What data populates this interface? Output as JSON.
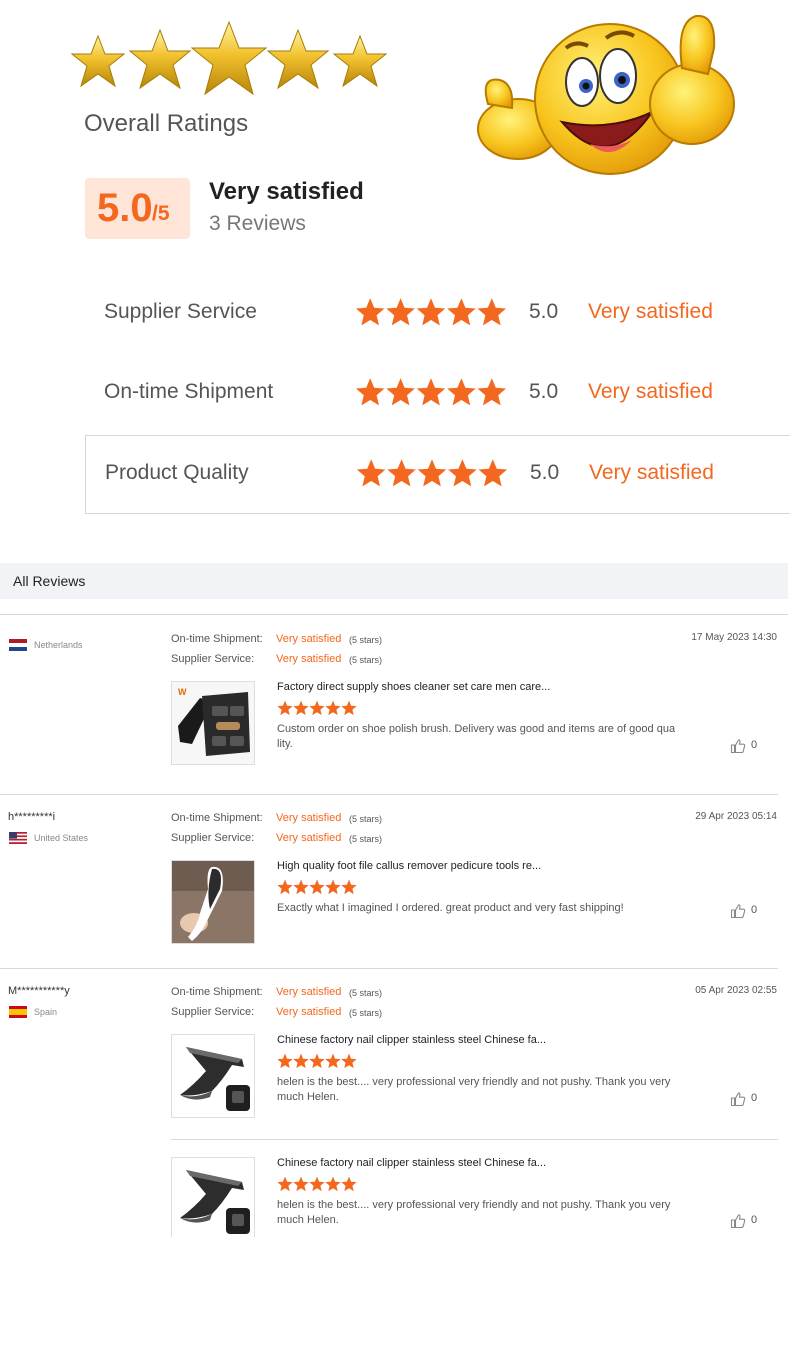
{
  "overall": {
    "title": "Overall Ratings",
    "score": "5.0",
    "score_den": "/5",
    "summary_label": "Very satisfied",
    "review_count": "3 Reviews",
    "star_rating": 5
  },
  "dimensions": [
    {
      "label": "Supplier Service",
      "stars": 5,
      "score": "5.0",
      "text": "Very satisfied"
    },
    {
      "label": "On-time Shipment",
      "stars": 5,
      "score": "5.0",
      "text": "Very satisfied"
    },
    {
      "label": "Product Quality",
      "stars": 5,
      "score": "5.0",
      "text": "Very satisfied"
    }
  ],
  "all_reviews_title": "All Reviews",
  "reviews": [
    {
      "name": "",
      "country": "Netherlands",
      "date": "17 May 2023 14:30",
      "shipment_label": "On-time Shipment:",
      "shipment_value": "Very satisfied",
      "shipment_stars": "(5 stars)",
      "service_label": "Supplier Service:",
      "service_value": "Very satisfied",
      "service_stars": "(5 stars)",
      "products": [
        {
          "title": "Factory direct supply shoes cleaner set care men care...",
          "stars": 5,
          "comment": "Custom order on shoe polish brush. Delivery was good and items are of good qua lity.",
          "likes": "0"
        }
      ]
    },
    {
      "name": "h*********i",
      "country": "United States",
      "date": "29 Apr 2023 05:14",
      "shipment_label": "On-time Shipment:",
      "shipment_value": "Very satisfied",
      "shipment_stars": "(5 stars)",
      "service_label": "Supplier Service:",
      "service_value": "Very satisfied",
      "service_stars": "(5 stars)",
      "products": [
        {
          "title": "High quality foot file callus remover pedicure tools re...",
          "stars": 5,
          "comment": "Exactly what I imagined I ordered. great product and very fast shipping!",
          "likes": "0"
        }
      ]
    },
    {
      "name": "M***********y",
      "country": "Spain",
      "date": "05 Apr 2023 02:55",
      "shipment_label": "On-time Shipment:",
      "shipment_value": "Very satisfied",
      "shipment_stars": "(5 stars)",
      "service_label": "Supplier Service:",
      "service_value": "Very satisfied",
      "service_stars": "(5 stars)",
      "products": [
        {
          "title": "Chinese factory nail clipper stainless steel Chinese fa...",
          "stars": 5,
          "comment": "helen is the best.... very professional very friendly and not pushy. Thank you very much Helen.",
          "likes": "0"
        },
        {
          "title": "Chinese factory nail clipper stainless steel Chinese fa...",
          "stars": 5,
          "comment": "helen is the best.... very professional very friendly and not pushy. Thank you very much Helen.",
          "likes": "0"
        }
      ]
    }
  ],
  "colors": {
    "accent": "#f4671f",
    "score_bg": "#ffe4d8",
    "gold_star": "#f2c12e",
    "section_bg": "#f2f3f7"
  },
  "icons": {
    "rating_star": "star-icon",
    "like": "thumbs-up-icon",
    "flag_netherlands": "flag-netherlands-icon",
    "flag_us": "flag-united-states-icon",
    "flag_spain": "flag-spain-icon"
  }
}
